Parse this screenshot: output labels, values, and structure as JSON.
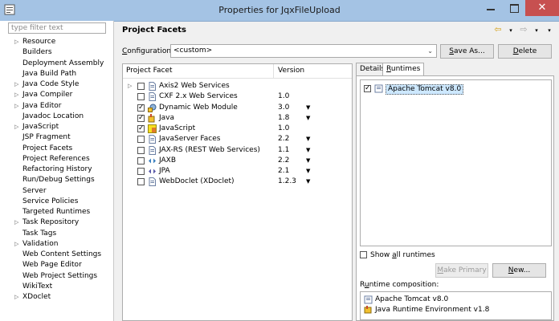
{
  "window": {
    "title": "Properties for JqxFileUpload",
    "close_glyph": "✕"
  },
  "filter": {
    "placeholder": "type filter text"
  },
  "tree": [
    {
      "label": "Resource",
      "expandable": true
    },
    {
      "label": "Builders",
      "expandable": false
    },
    {
      "label": "Deployment Assembly",
      "expandable": false
    },
    {
      "label": "Java Build Path",
      "expandable": false
    },
    {
      "label": "Java Code Style",
      "expandable": true
    },
    {
      "label": "Java Compiler",
      "expandable": true
    },
    {
      "label": "Java Editor",
      "expandable": true
    },
    {
      "label": "Javadoc Location",
      "expandable": false
    },
    {
      "label": "JavaScript",
      "expandable": true
    },
    {
      "label": "JSP Fragment",
      "expandable": false
    },
    {
      "label": "Project Facets",
      "expandable": false,
      "selected": true
    },
    {
      "label": "Project References",
      "expandable": false
    },
    {
      "label": "Refactoring History",
      "expandable": false
    },
    {
      "label": "Run/Debug Settings",
      "expandable": false
    },
    {
      "label": "Server",
      "expandable": false
    },
    {
      "label": "Service Policies",
      "expandable": false
    },
    {
      "label": "Targeted Runtimes",
      "expandable": false
    },
    {
      "label": "Task Repository",
      "expandable": true
    },
    {
      "label": "Task Tags",
      "expandable": false
    },
    {
      "label": "Validation",
      "expandable": true
    },
    {
      "label": "Web Content Settings",
      "expandable": false
    },
    {
      "label": "Web Page Editor",
      "expandable": false
    },
    {
      "label": "Web Project Settings",
      "expandable": false
    },
    {
      "label": "WikiText",
      "expandable": false
    },
    {
      "label": "XDoclet",
      "expandable": true
    }
  ],
  "page": {
    "title": "Project Facets",
    "configuration_label": "Configuration:",
    "configuration_value": "<custom>",
    "save_as": "Save As...",
    "delete": "Delete"
  },
  "facets": {
    "col_facet": "Project Facet",
    "col_version": "Version",
    "rows": [
      {
        "name": "Axis2 Web Services",
        "version": "",
        "checked": false,
        "expandable": true,
        "dropdown": false,
        "icon": "page-icon"
      },
      {
        "name": "CXF 2.x Web Services",
        "version": "1.0",
        "checked": false,
        "expandable": false,
        "dropdown": false,
        "icon": "page-icon"
      },
      {
        "name": "Dynamic Web Module",
        "version": "3.0",
        "checked": true,
        "expandable": false,
        "dropdown": true,
        "icon": "web-module-icon"
      },
      {
        "name": "Java",
        "version": "1.8",
        "checked": true,
        "expandable": false,
        "dropdown": true,
        "icon": "java-icon"
      },
      {
        "name": "JavaScript",
        "version": "1.0",
        "checked": true,
        "expandable": false,
        "dropdown": false,
        "icon": "javascript-icon"
      },
      {
        "name": "JavaServer Faces",
        "version": "2.2",
        "checked": false,
        "expandable": false,
        "dropdown": true,
        "icon": "page-icon"
      },
      {
        "name": "JAX-RS (REST Web Services)",
        "version": "1.1",
        "checked": false,
        "expandable": false,
        "dropdown": true,
        "icon": "page-icon"
      },
      {
        "name": "JAXB",
        "version": "2.2",
        "checked": false,
        "expandable": false,
        "dropdown": true,
        "icon": "jaxb-icon"
      },
      {
        "name": "JPA",
        "version": "2.1",
        "checked": false,
        "expandable": false,
        "dropdown": true,
        "icon": "jpa-icon"
      },
      {
        "name": "WebDoclet (XDoclet)",
        "version": "1.2.3",
        "checked": false,
        "expandable": false,
        "dropdown": true,
        "icon": "page-icon"
      }
    ]
  },
  "tabs": {
    "details": "Details",
    "runtimes": "Runtimes"
  },
  "runtimes": {
    "items": [
      {
        "label": "Apache Tomcat v8.0",
        "checked": true
      }
    ],
    "show_all": "Show all runtimes",
    "make_primary": "Make Primary",
    "new": "New...",
    "composition_label": "Runtime composition:",
    "composition": [
      {
        "label": "Apache Tomcat v8.0",
        "icon": "tomcat-icon"
      },
      {
        "label": "Java Runtime Environment v1.8",
        "icon": "jre-icon"
      }
    ]
  }
}
